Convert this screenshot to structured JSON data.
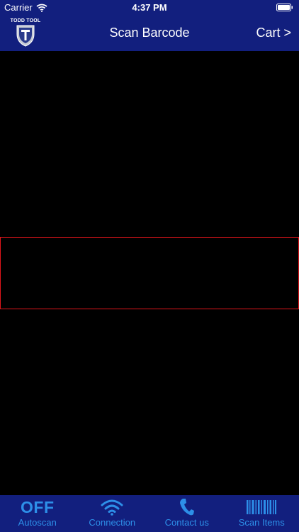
{
  "status_bar": {
    "carrier": "Carrier",
    "time": "4:37 PM"
  },
  "nav": {
    "logo_text": "TODD TOOL",
    "title": "Scan Barcode",
    "cart_label": "Cart >"
  },
  "tabs": [
    {
      "icon_text": "OFF",
      "label": "Autoscan",
      "icon": "off-text-icon"
    },
    {
      "label": "Connection",
      "icon": "wifi-icon"
    },
    {
      "label": "Contact us",
      "icon": "phone-icon"
    },
    {
      "label": "Scan Items",
      "icon": "barcode-icon"
    }
  ],
  "colors": {
    "header_bg": "#121f7e",
    "tab_accent": "#2d8fe8",
    "scan_frame": "#e0151a"
  }
}
